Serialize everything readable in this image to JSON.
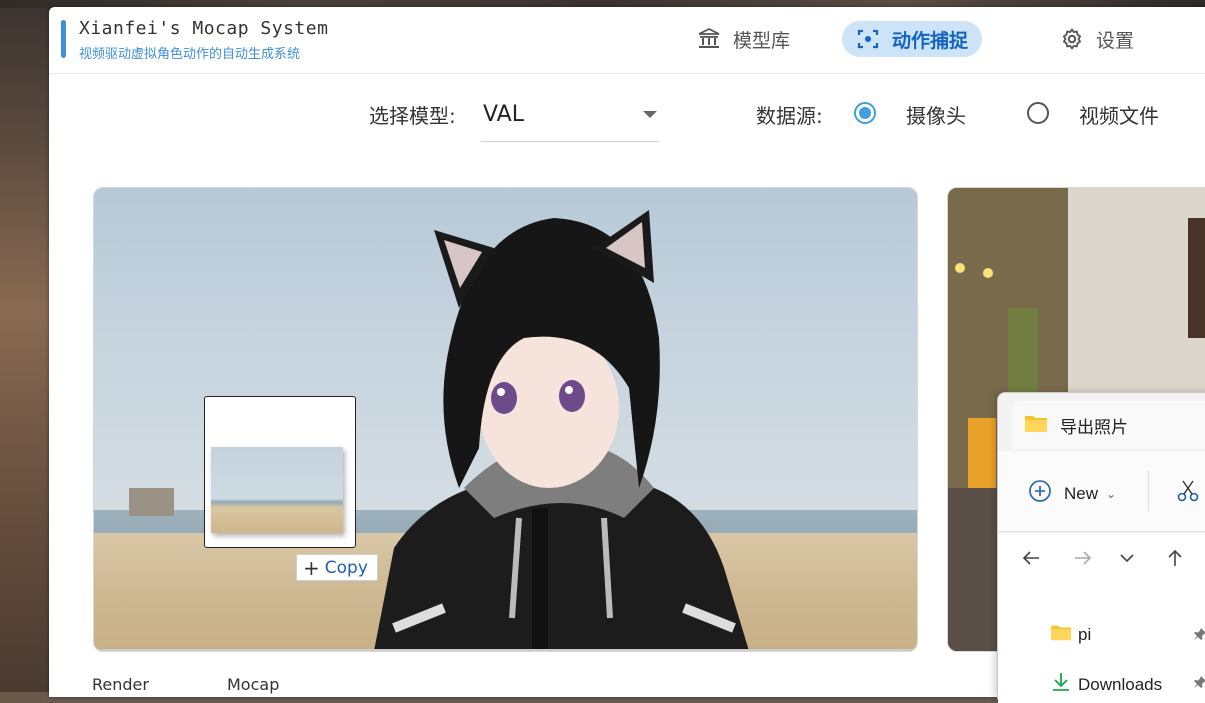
{
  "app": {
    "title": "Xianfei's Mocap System",
    "subtitle": "视频驱动虚拟角色动作的自动生成系统",
    "accent_color": "#3f8fd8"
  },
  "nav": {
    "items": [
      {
        "label": "模型库",
        "icon": "library-icon"
      },
      {
        "label": "动作捕捉",
        "icon": "scan-icon",
        "active": true
      },
      {
        "label": "设置",
        "icon": "gear-icon"
      }
    ]
  },
  "controls": {
    "model_label": "选择模型:",
    "model_value": "VAL",
    "source_label": "数据源:",
    "source_options": [
      {
        "label": "摄像头",
        "selected": true
      },
      {
        "label": "视频文件",
        "selected": false
      }
    ]
  },
  "drag": {
    "copy_label": "Copy"
  },
  "tabs": [
    "Render",
    "Mocap"
  ],
  "explorer": {
    "tab_title": "导出照片",
    "new_label": "New",
    "items": [
      {
        "label": "pi",
        "icon": "folder-icon"
      },
      {
        "label": "Downloads",
        "icon": "download-icon"
      }
    ]
  }
}
